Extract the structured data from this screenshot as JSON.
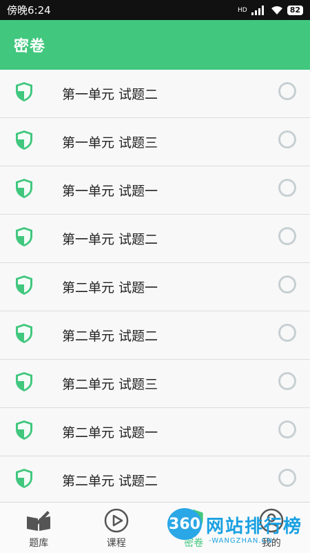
{
  "status": {
    "time": "傍晚6:24",
    "network": "HD",
    "battery": "82"
  },
  "app": {
    "title": "密卷"
  },
  "list": [
    {
      "label": "第一单元 试题二"
    },
    {
      "label": "第一单元 试题三"
    },
    {
      "label": "第一单元 试题一"
    },
    {
      "label": "第一单元 试题二"
    },
    {
      "label": "第二单元 试题一"
    },
    {
      "label": "第二单元 试题二"
    },
    {
      "label": "第二单元 试题三"
    },
    {
      "label": "第二单元 试题一"
    },
    {
      "label": "第二单元 试题二"
    }
  ],
  "colors": {
    "accent": "#41c77e",
    "shield": "#41c77e",
    "radio": "#c7cfd2"
  },
  "bottom_nav": [
    {
      "label": "题库",
      "icon": "book-pencil-icon"
    },
    {
      "label": "课程",
      "icon": "play-circle-icon"
    },
    {
      "label": "密卷",
      "icon": "shield-icon"
    },
    {
      "label": "我的",
      "icon": "user-circle-icon"
    }
  ],
  "watermark": {
    "badge": "360",
    "text": "网站排行榜",
    "sub": "-WANGZHAN.CN-"
  }
}
